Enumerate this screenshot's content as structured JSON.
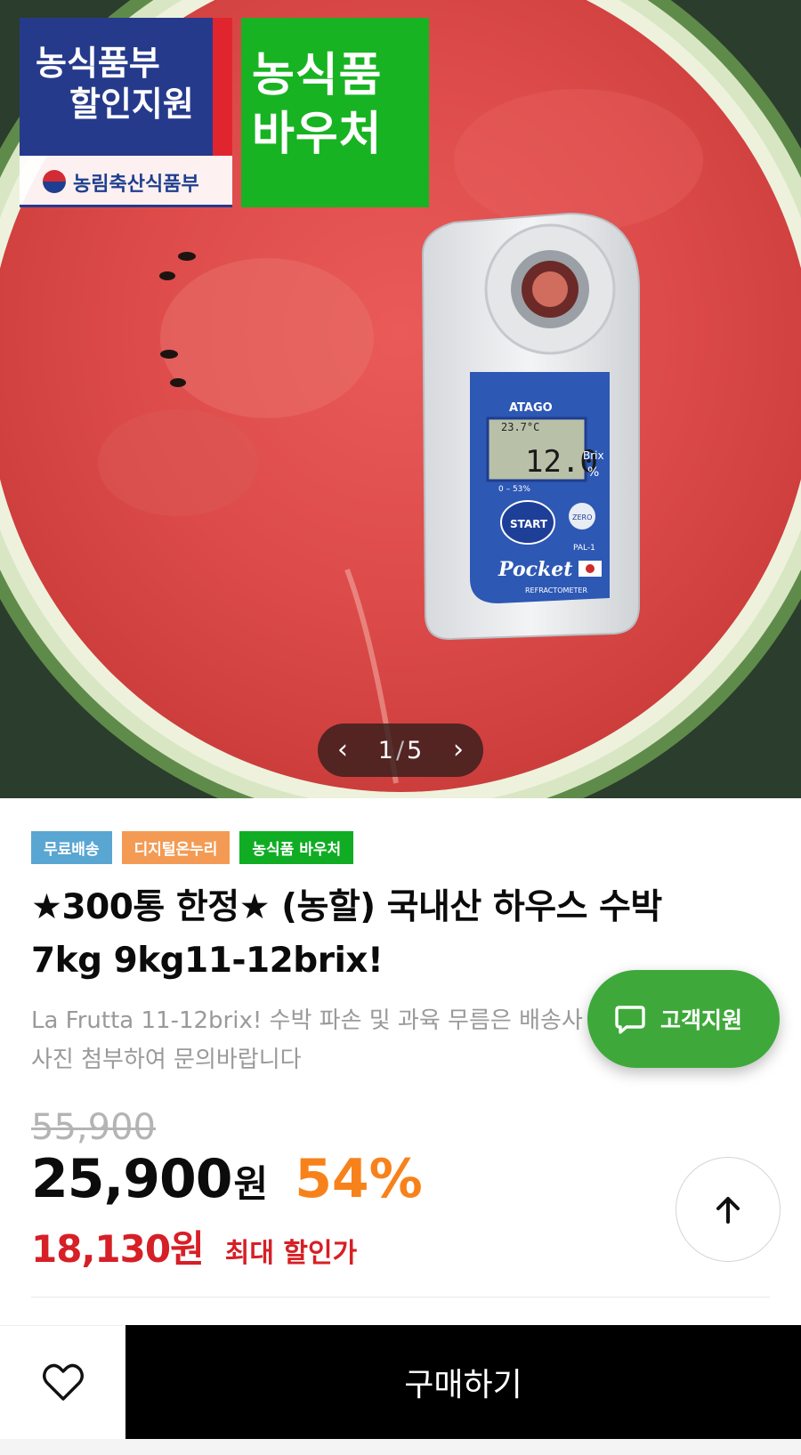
{
  "image": {
    "gov_badge": {
      "line1": "농식품부",
      "line2": "할인지원",
      "ministry": "농림축산식품부",
      "voucher_line1": "농식품",
      "voucher_line2": "바우처"
    },
    "slider": {
      "current": "1",
      "total": "5",
      "separator": "/",
      "prev_icon": "chevron-left-icon",
      "next_icon": "chevron-right-icon"
    },
    "meter": {
      "brand": "ATAGO",
      "temp": "23.7°C",
      "reading": "12.0",
      "unit_top": "Brix",
      "unit_bottom": "%",
      "range": "0 – 53%",
      "start": "START",
      "zero": "ZERO",
      "model": "PAL-1",
      "pocket": "Pocket",
      "refractometer": "REFRACTOMETER"
    }
  },
  "tags": [
    {
      "label": "무료배송",
      "color": "#59a6d3"
    },
    {
      "label": "디지털온누리",
      "color": "#f39b54"
    },
    {
      "label": "농식품 바우처",
      "color": "#10ad24"
    }
  ],
  "product": {
    "title": "★300통 한정★ (농할) 국내산 하우스 수박 7kg 9kg11-12brix!",
    "subtitle": "La Frutta 11-12brix! 수박 파손 및 과육 무름은 배송사 사진 첨부하여 문의바랍니다"
  },
  "support": {
    "label": "고객지원",
    "icon": "chat-bubble-icon"
  },
  "price": {
    "original": "55,900",
    "sale": "25,900",
    "unit": "원",
    "discount": "54%",
    "max_price": "18,130원",
    "max_label": "최대 할인가"
  },
  "scroll_top": {
    "icon": "arrow-up-icon"
  },
  "bottom": {
    "wish_icon": "heart-icon",
    "buy_label": "구매하기"
  },
  "colors": {
    "discount": "#f7821b",
    "max_price": "#d61f26",
    "support_button": "#3ea93a",
    "buy_button": "#000000"
  }
}
